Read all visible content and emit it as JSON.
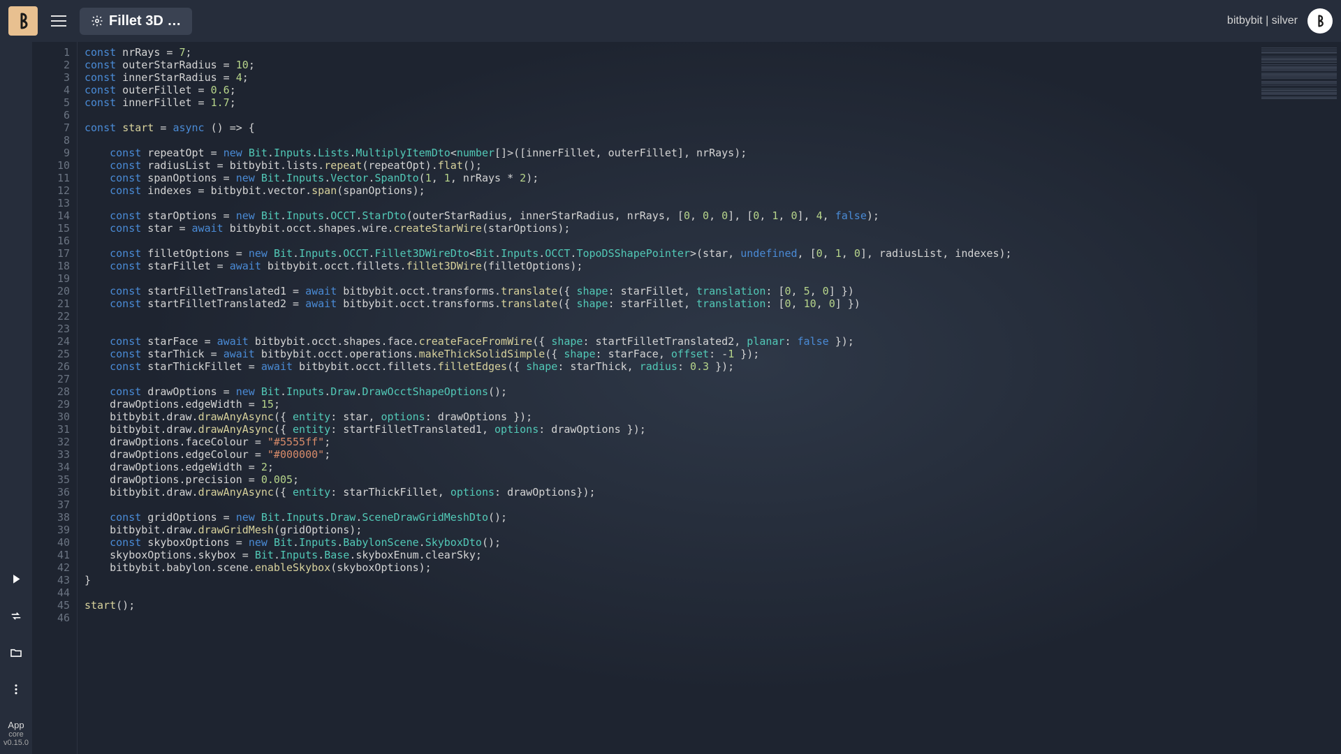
{
  "topbar": {
    "title": "Fillet 3D …",
    "user_label": "bitbybit | silver"
  },
  "sidebar": {
    "app_label": "App",
    "core": "core",
    "version": "v0.15.0"
  },
  "code": {
    "lines": [
      [
        [
          "kw",
          "const"
        ],
        [
          "",
          " nrRays = "
        ],
        [
          "num",
          "7"
        ],
        [
          "",
          ";"
        ]
      ],
      [
        [
          "kw",
          "const"
        ],
        [
          "",
          " outerStarRadius = "
        ],
        [
          "num",
          "10"
        ],
        [
          "",
          ";"
        ]
      ],
      [
        [
          "kw",
          "const"
        ],
        [
          "",
          " innerStarRadius = "
        ],
        [
          "num",
          "4"
        ],
        [
          "",
          ";"
        ]
      ],
      [
        [
          "kw",
          "const"
        ],
        [
          "",
          " outerFillet = "
        ],
        [
          "num",
          "0.6"
        ],
        [
          "",
          ";"
        ]
      ],
      [
        [
          "kw",
          "const"
        ],
        [
          "",
          " innerFillet = "
        ],
        [
          "num",
          "1.7"
        ],
        [
          "",
          ";"
        ]
      ],
      [
        [
          "",
          ""
        ]
      ],
      [
        [
          "kw",
          "const"
        ],
        [
          "",
          " "
        ],
        [
          "fn",
          "start"
        ],
        [
          "",
          " = "
        ],
        [
          "kw",
          "async"
        ],
        [
          "",
          " () => {"
        ]
      ],
      [
        [
          "",
          ""
        ]
      ],
      [
        [
          "",
          "    "
        ],
        [
          "kw",
          "const"
        ],
        [
          "",
          " repeatOpt = "
        ],
        [
          "kw",
          "new"
        ],
        [
          "",
          " "
        ],
        [
          "type",
          "Bit"
        ],
        [
          "",
          "."
        ],
        [
          "type",
          "Inputs"
        ],
        [
          "",
          "."
        ],
        [
          "type",
          "Lists"
        ],
        [
          "",
          "."
        ],
        [
          "type",
          "MultiplyItemDto"
        ],
        [
          "",
          "<"
        ],
        [
          "type",
          "number"
        ],
        [
          "",
          "[]>([innerFillet, outerFillet], nrRays);"
        ]
      ],
      [
        [
          "",
          "    "
        ],
        [
          "kw",
          "const"
        ],
        [
          "",
          " radiusList = bitbybit.lists."
        ],
        [
          "fn",
          "repeat"
        ],
        [
          "",
          "(repeatOpt)."
        ],
        [
          "fn",
          "flat"
        ],
        [
          "",
          "();"
        ]
      ],
      [
        [
          "",
          "    "
        ],
        [
          "kw",
          "const"
        ],
        [
          "",
          " spanOptions = "
        ],
        [
          "kw",
          "new"
        ],
        [
          "",
          " "
        ],
        [
          "type",
          "Bit"
        ],
        [
          "",
          "."
        ],
        [
          "type",
          "Inputs"
        ],
        [
          "",
          "."
        ],
        [
          "type",
          "Vector"
        ],
        [
          "",
          "."
        ],
        [
          "type",
          "SpanDto"
        ],
        [
          "",
          "("
        ],
        [
          "num",
          "1"
        ],
        [
          "",
          ", "
        ],
        [
          "num",
          "1"
        ],
        [
          "",
          ", nrRays * "
        ],
        [
          "num",
          "2"
        ],
        [
          "",
          ");"
        ]
      ],
      [
        [
          "",
          "    "
        ],
        [
          "kw",
          "const"
        ],
        [
          "",
          " indexes = bitbybit.vector."
        ],
        [
          "fn",
          "span"
        ],
        [
          "",
          "(spanOptions);"
        ]
      ],
      [
        [
          "",
          ""
        ]
      ],
      [
        [
          "",
          "    "
        ],
        [
          "kw",
          "const"
        ],
        [
          "",
          " starOptions = "
        ],
        [
          "kw",
          "new"
        ],
        [
          "",
          " "
        ],
        [
          "type",
          "Bit"
        ],
        [
          "",
          "."
        ],
        [
          "type",
          "Inputs"
        ],
        [
          "",
          "."
        ],
        [
          "type",
          "OCCT"
        ],
        [
          "",
          "."
        ],
        [
          "type",
          "StarDto"
        ],
        [
          "",
          "(outerStarRadius, innerStarRadius, nrRays, ["
        ],
        [
          "num",
          "0"
        ],
        [
          "",
          ", "
        ],
        [
          "num",
          "0"
        ],
        [
          "",
          ", "
        ],
        [
          "num",
          "0"
        ],
        [
          "",
          "], ["
        ],
        [
          "num",
          "0"
        ],
        [
          "",
          ", "
        ],
        [
          "num",
          "1"
        ],
        [
          "",
          ", "
        ],
        [
          "num",
          "0"
        ],
        [
          "",
          "], "
        ],
        [
          "num",
          "4"
        ],
        [
          "",
          ", "
        ],
        [
          "bool",
          "false"
        ],
        [
          "",
          ");"
        ]
      ],
      [
        [
          "",
          "    "
        ],
        [
          "kw",
          "const"
        ],
        [
          "",
          " star = "
        ],
        [
          "kw",
          "await"
        ],
        [
          "",
          " bitbybit.occt.shapes.wire."
        ],
        [
          "fn",
          "createStarWire"
        ],
        [
          "",
          "(starOptions);"
        ]
      ],
      [
        [
          "",
          ""
        ]
      ],
      [
        [
          "",
          "    "
        ],
        [
          "kw",
          "const"
        ],
        [
          "",
          " filletOptions = "
        ],
        [
          "kw",
          "new"
        ],
        [
          "",
          " "
        ],
        [
          "type",
          "Bit"
        ],
        [
          "",
          "."
        ],
        [
          "type",
          "Inputs"
        ],
        [
          "",
          "."
        ],
        [
          "type",
          "OCCT"
        ],
        [
          "",
          "."
        ],
        [
          "type",
          "Fillet3DWireDto"
        ],
        [
          "",
          "<"
        ],
        [
          "type",
          "Bit"
        ],
        [
          "",
          "."
        ],
        [
          "type",
          "Inputs"
        ],
        [
          "",
          "."
        ],
        [
          "type",
          "OCCT"
        ],
        [
          "",
          "."
        ],
        [
          "type",
          "TopoDSShapePointer"
        ],
        [
          "",
          ">(star, "
        ],
        [
          "undef",
          "undefined"
        ],
        [
          "",
          ", ["
        ],
        [
          "num",
          "0"
        ],
        [
          "",
          ", "
        ],
        [
          "num",
          "1"
        ],
        [
          "",
          ", "
        ],
        [
          "num",
          "0"
        ],
        [
          "",
          "], radiusList, indexes);"
        ]
      ],
      [
        [
          "",
          "    "
        ],
        [
          "kw",
          "const"
        ],
        [
          "",
          " starFillet = "
        ],
        [
          "kw",
          "await"
        ],
        [
          "",
          " bitbybit.occt.fillets."
        ],
        [
          "fn",
          "fillet3DWire"
        ],
        [
          "",
          "(filletOptions);"
        ]
      ],
      [
        [
          "",
          ""
        ]
      ],
      [
        [
          "",
          "    "
        ],
        [
          "kw",
          "const"
        ],
        [
          "",
          " startFilletTranslated1 = "
        ],
        [
          "kw",
          "await"
        ],
        [
          "",
          " bitbybit.occt.transforms."
        ],
        [
          "fn",
          "translate"
        ],
        [
          "",
          "({ "
        ],
        [
          "type",
          "shape"
        ],
        [
          "",
          ": starFillet, "
        ],
        [
          "type",
          "translation"
        ],
        [
          "",
          ": ["
        ],
        [
          "num",
          "0"
        ],
        [
          "",
          ", "
        ],
        [
          "num",
          "5"
        ],
        [
          "",
          ", "
        ],
        [
          "num",
          "0"
        ],
        [
          "",
          "] })"
        ]
      ],
      [
        [
          "",
          "    "
        ],
        [
          "kw",
          "const"
        ],
        [
          "",
          " startFilletTranslated2 = "
        ],
        [
          "kw",
          "await"
        ],
        [
          "",
          " bitbybit.occt.transforms."
        ],
        [
          "fn",
          "translate"
        ],
        [
          "",
          "({ "
        ],
        [
          "type",
          "shape"
        ],
        [
          "",
          ": starFillet, "
        ],
        [
          "type",
          "translation"
        ],
        [
          "",
          ": ["
        ],
        [
          "num",
          "0"
        ],
        [
          "",
          ", "
        ],
        [
          "num",
          "10"
        ],
        [
          "",
          ", "
        ],
        [
          "num",
          "0"
        ],
        [
          "",
          "] })"
        ]
      ],
      [
        [
          "",
          ""
        ]
      ],
      [
        [
          "",
          ""
        ]
      ],
      [
        [
          "",
          "    "
        ],
        [
          "kw",
          "const"
        ],
        [
          "",
          " starFace = "
        ],
        [
          "kw",
          "await"
        ],
        [
          "",
          " bitbybit.occt.shapes.face."
        ],
        [
          "fn",
          "createFaceFromWire"
        ],
        [
          "",
          "({ "
        ],
        [
          "type",
          "shape"
        ],
        [
          "",
          ": startFilletTranslated2, "
        ],
        [
          "type",
          "planar"
        ],
        [
          "",
          ": "
        ],
        [
          "bool",
          "false"
        ],
        [
          "",
          " });"
        ]
      ],
      [
        [
          "",
          "    "
        ],
        [
          "kw",
          "const"
        ],
        [
          "",
          " starThick = "
        ],
        [
          "kw",
          "await"
        ],
        [
          "",
          " bitbybit.occt.operations."
        ],
        [
          "fn",
          "makeThickSolidSimple"
        ],
        [
          "",
          "({ "
        ],
        [
          "type",
          "shape"
        ],
        [
          "",
          ": starFace, "
        ],
        [
          "type",
          "offset"
        ],
        [
          "",
          ": -"
        ],
        [
          "num",
          "1"
        ],
        [
          "",
          " });"
        ]
      ],
      [
        [
          "",
          "    "
        ],
        [
          "kw",
          "const"
        ],
        [
          "",
          " starThickFillet = "
        ],
        [
          "kw",
          "await"
        ],
        [
          "",
          " bitbybit.occt.fillets."
        ],
        [
          "fn",
          "filletEdges"
        ],
        [
          "",
          "({ "
        ],
        [
          "type",
          "shape"
        ],
        [
          "",
          ": starThick, "
        ],
        [
          "type",
          "radius"
        ],
        [
          "",
          ": "
        ],
        [
          "num",
          "0.3"
        ],
        [
          "",
          " });"
        ]
      ],
      [
        [
          "",
          ""
        ]
      ],
      [
        [
          "",
          "    "
        ],
        [
          "kw",
          "const"
        ],
        [
          "",
          " drawOptions = "
        ],
        [
          "kw",
          "new"
        ],
        [
          "",
          " "
        ],
        [
          "type",
          "Bit"
        ],
        [
          "",
          "."
        ],
        [
          "type",
          "Inputs"
        ],
        [
          "",
          "."
        ],
        [
          "type",
          "Draw"
        ],
        [
          "",
          "."
        ],
        [
          "type",
          "DrawOcctShapeOptions"
        ],
        [
          "",
          "();"
        ]
      ],
      [
        [
          "",
          "    drawOptions.edgeWidth = "
        ],
        [
          "num",
          "15"
        ],
        [
          "",
          ";"
        ]
      ],
      [
        [
          "",
          "    bitbybit.draw."
        ],
        [
          "fn",
          "drawAnyAsync"
        ],
        [
          "",
          "({ "
        ],
        [
          "type",
          "entity"
        ],
        [
          "",
          ": star, "
        ],
        [
          "type",
          "options"
        ],
        [
          "",
          ": drawOptions });"
        ]
      ],
      [
        [
          "",
          "    bitbybit.draw."
        ],
        [
          "fn",
          "drawAnyAsync"
        ],
        [
          "",
          "({ "
        ],
        [
          "type",
          "entity"
        ],
        [
          "",
          ": startFilletTranslated1, "
        ],
        [
          "type",
          "options"
        ],
        [
          "",
          ": drawOptions });"
        ]
      ],
      [
        [
          "",
          "    drawOptions.faceColour = "
        ],
        [
          "str",
          "\"#5555ff\""
        ],
        [
          "",
          ";"
        ]
      ],
      [
        [
          "",
          "    drawOptions.edgeColour = "
        ],
        [
          "str",
          "\"#000000\""
        ],
        [
          "",
          ";"
        ]
      ],
      [
        [
          "",
          "    drawOptions.edgeWidth = "
        ],
        [
          "num",
          "2"
        ],
        [
          "",
          ";"
        ]
      ],
      [
        [
          "",
          "    drawOptions.precision = "
        ],
        [
          "num",
          "0.005"
        ],
        [
          "",
          ";"
        ]
      ],
      [
        [
          "",
          "    bitbybit.draw."
        ],
        [
          "fn",
          "drawAnyAsync"
        ],
        [
          "",
          "({ "
        ],
        [
          "type",
          "entity"
        ],
        [
          "",
          ": starThickFillet, "
        ],
        [
          "type",
          "options"
        ],
        [
          "",
          ": drawOptions});"
        ]
      ],
      [
        [
          "",
          ""
        ]
      ],
      [
        [
          "",
          "    "
        ],
        [
          "kw",
          "const"
        ],
        [
          "",
          " gridOptions = "
        ],
        [
          "kw",
          "new"
        ],
        [
          "",
          " "
        ],
        [
          "type",
          "Bit"
        ],
        [
          "",
          "."
        ],
        [
          "type",
          "Inputs"
        ],
        [
          "",
          "."
        ],
        [
          "type",
          "Draw"
        ],
        [
          "",
          "."
        ],
        [
          "type",
          "SceneDrawGridMeshDto"
        ],
        [
          "",
          "();"
        ]
      ],
      [
        [
          "",
          "    bitbybit.draw."
        ],
        [
          "fn",
          "drawGridMesh"
        ],
        [
          "",
          "(gridOptions);"
        ]
      ],
      [
        [
          "",
          "    "
        ],
        [
          "kw",
          "const"
        ],
        [
          "",
          " skyboxOptions = "
        ],
        [
          "kw",
          "new"
        ],
        [
          "",
          " "
        ],
        [
          "type",
          "Bit"
        ],
        [
          "",
          "."
        ],
        [
          "type",
          "Inputs"
        ],
        [
          "",
          "."
        ],
        [
          "type",
          "BabylonScene"
        ],
        [
          "",
          "."
        ],
        [
          "type",
          "SkyboxDto"
        ],
        [
          "",
          "();"
        ]
      ],
      [
        [
          "",
          "    skyboxOptions.skybox = "
        ],
        [
          "type",
          "Bit"
        ],
        [
          "",
          "."
        ],
        [
          "type",
          "Inputs"
        ],
        [
          "",
          "."
        ],
        [
          "type",
          "Base"
        ],
        [
          "",
          ".skyboxEnum.clearSky;"
        ]
      ],
      [
        [
          "",
          "    bitbybit.babylon.scene."
        ],
        [
          "fn",
          "enableSkybox"
        ],
        [
          "",
          "(skyboxOptions);"
        ]
      ],
      [
        [
          "",
          "}"
        ]
      ],
      [
        [
          "",
          ""
        ]
      ],
      [
        [
          "fn",
          "start"
        ],
        [
          "",
          "();"
        ]
      ],
      [
        [
          "",
          ""
        ]
      ]
    ]
  },
  "minimap": {
    "rows": [
      8,
      10,
      12,
      14,
      16,
      20,
      22,
      24,
      26,
      28,
      32,
      34,
      36,
      38,
      40,
      44,
      46,
      48,
      50,
      52,
      56,
      58,
      60,
      62,
      66,
      68,
      70,
      72,
      74,
      78,
      80
    ]
  }
}
